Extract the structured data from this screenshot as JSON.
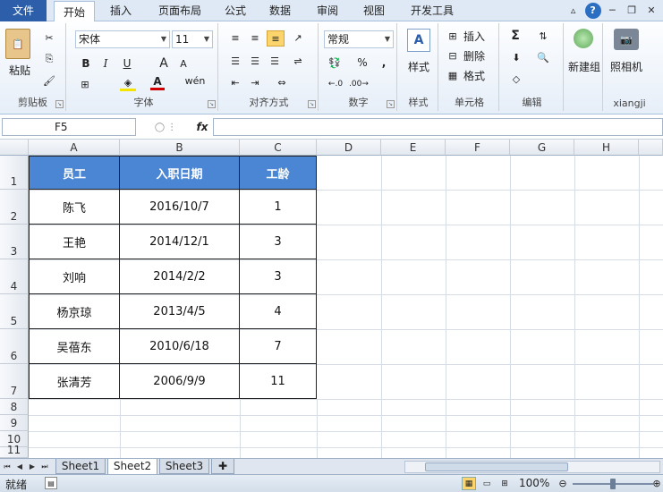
{
  "tabs": {
    "file": "文件",
    "home": "开始",
    "insert": "插入",
    "layout": "页面布局",
    "formulas": "公式",
    "data": "数据",
    "review": "审阅",
    "view": "视图",
    "developer": "开发工具"
  },
  "ribbon": {
    "clipboard": {
      "label": "剪贴板",
      "paste": "粘贴"
    },
    "font": {
      "label": "字体",
      "name": "宋体",
      "size": "11",
      "bold": "B",
      "italic": "I",
      "underline": "U",
      "grow": "A",
      "shrink": "A",
      "color_glyph": "A",
      "wen": "wén"
    },
    "alignment": {
      "label": "对齐方式"
    },
    "number": {
      "label": "数字",
      "format": "常规",
      "percent": "%",
      "comma": ","
    },
    "styles": {
      "label": "样式",
      "button": "样式"
    },
    "cells": {
      "label": "单元格",
      "insert": "插入",
      "delete": "删除",
      "format": "格式"
    },
    "editing": {
      "label": "编辑",
      "sum": "Σ"
    },
    "newgroup": {
      "button": "新建组"
    },
    "xiangji": {
      "label": "xiangji",
      "camera": "照相机"
    }
  },
  "formula_bar": {
    "name_box": "F5",
    "fx": "fx",
    "value": ""
  },
  "columns": [
    "A",
    "B",
    "C",
    "D",
    "E",
    "F",
    "G",
    "H"
  ],
  "rows": [
    "1",
    "2",
    "3",
    "4",
    "5",
    "6",
    "7",
    "8",
    "9",
    "10",
    "11"
  ],
  "table": {
    "headers": [
      "员工",
      "入职日期",
      "工龄"
    ],
    "rows": [
      [
        "陈飞",
        "2016/10/7",
        "1"
      ],
      [
        "王艳",
        "2014/12/1",
        "3"
      ],
      [
        "刘响",
        "2014/2/2",
        "3"
      ],
      [
        "杨京琼",
        "2013/4/5",
        "4"
      ],
      [
        "吴蓓东",
        "2010/6/18",
        "7"
      ],
      [
        "张清芳",
        "2006/9/9",
        "11"
      ]
    ]
  },
  "sheets": [
    "Sheet1",
    "Sheet2",
    "Sheet3"
  ],
  "active_sheet": "Sheet2",
  "status": {
    "text": "就绪",
    "zoom": "100%"
  },
  "colors": {
    "header_fill": "#4a86d4",
    "file_tab": "#2c5ea9"
  }
}
